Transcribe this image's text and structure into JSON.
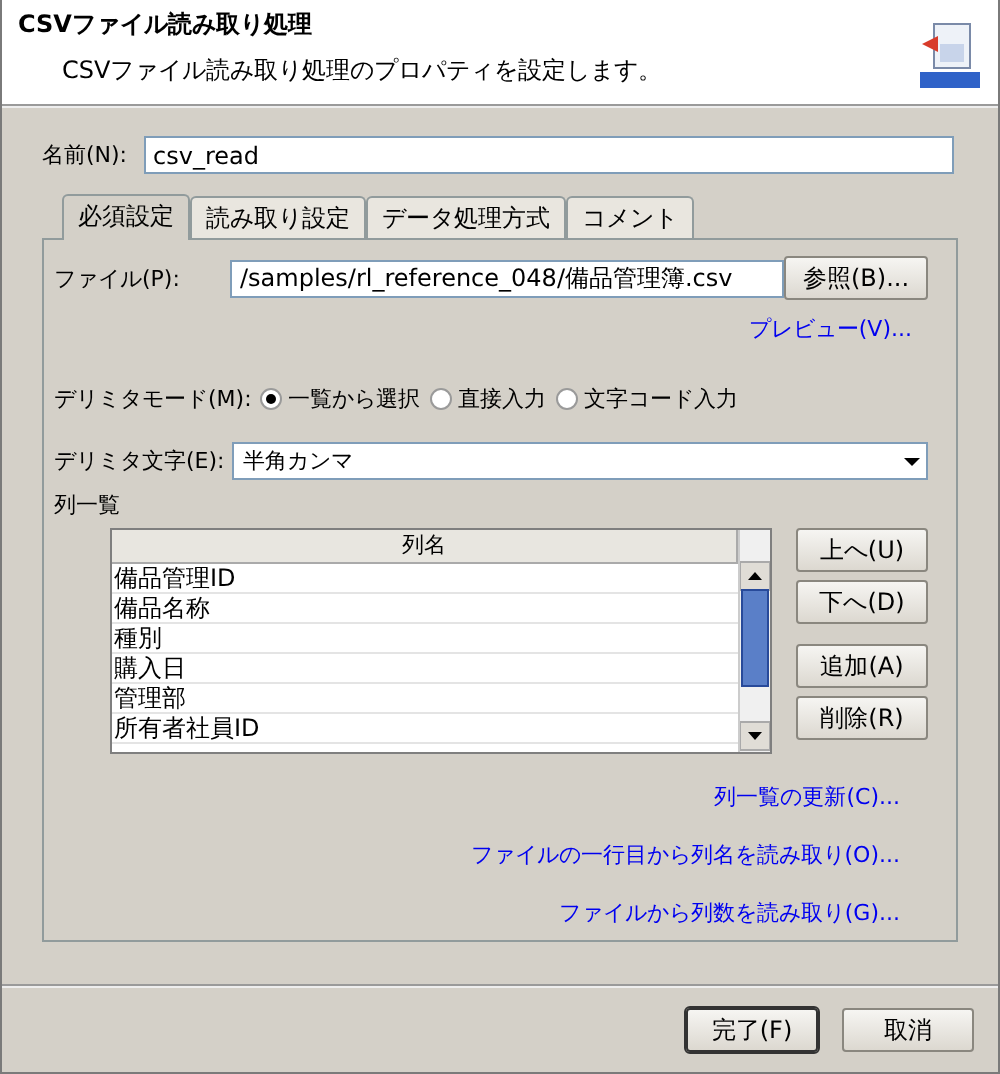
{
  "header": {
    "title": "CSVファイル読み取り処理",
    "subtitle": "CSVファイル読み取り処理のプロパティを設定します。"
  },
  "name_field": {
    "label": "名前(N):",
    "value": "csv_read"
  },
  "tabs": [
    {
      "label": "必須設定",
      "selected": true
    },
    {
      "label": "読み取り設定",
      "selected": false
    },
    {
      "label": "データ処理方式",
      "selected": false
    },
    {
      "label": "コメント",
      "selected": false
    }
  ],
  "file_field": {
    "label": "ファイル(P):",
    "value": "/samples/rl_reference_048/備品管理簿.csv",
    "button": "参照(B)..."
  },
  "preview_link": "プレビュー(V)...",
  "delimiter_mode": {
    "label": "デリミタモード(M):",
    "options": [
      {
        "label": "一覧から選択",
        "selected": true
      },
      {
        "label": "直接入力",
        "selected": false
      },
      {
        "label": "文字コード入力",
        "selected": false
      }
    ]
  },
  "delimiter_char": {
    "label": "デリミタ文字(E):",
    "value": "半角カンマ"
  },
  "column_list": {
    "label": "列一覧",
    "header": "列名",
    "rows": [
      "備品管理ID",
      "備品名称",
      "種別",
      "購入日",
      "管理部",
      "所有者社員ID"
    ],
    "buttons": [
      "上へ(U)",
      "下へ(D)",
      "追加(A)",
      "削除(R)"
    ]
  },
  "links": [
    "列一覧の更新(C)...",
    "ファイルの一行目から列名を読み取り(O)...",
    "ファイルから列数を読み取り(G)..."
  ],
  "footer_buttons": [
    {
      "label": "完了(F)",
      "default": true
    },
    {
      "label": "取消",
      "default": false
    }
  ]
}
